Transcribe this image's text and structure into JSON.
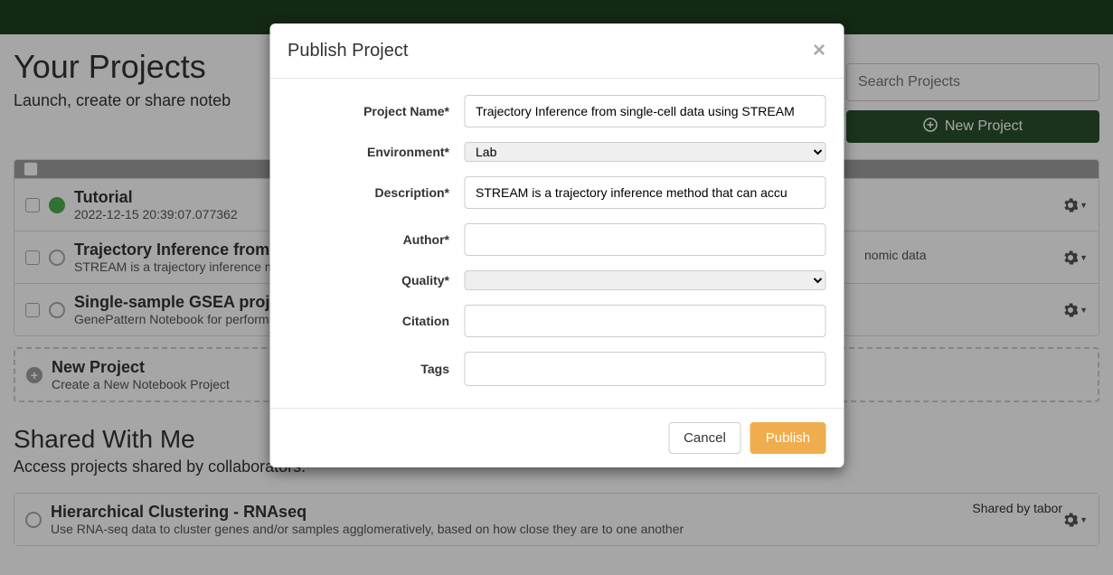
{
  "header": {
    "title": "Your Projects",
    "subtitle": "Launch, create or share noteb",
    "search_placeholder": "Search Projects",
    "new_project_btn": "New Project"
  },
  "projects": [
    {
      "title": "Tutorial",
      "subtitle": "2022-12-15 20:39:07.077362"
    },
    {
      "title": "Trajectory Inference from si",
      "subtitle": "STREAM is a trajectory inference me"
    },
    {
      "title": "Single-sample GSEA projec",
      "subtitle": "GenePattern Notebook for performin"
    }
  ],
  "orphan_text": "nomic data",
  "new_project_row": {
    "title": "New Project",
    "subtitle": "Create a New Notebook Project"
  },
  "shared": {
    "title": "Shared With Me",
    "subtitle": "Access projects shared by collaborators."
  },
  "shared_projects": [
    {
      "title": "Hierarchical Clustering - RNAseq",
      "subtitle": "Use RNA-seq data to cluster genes and/or samples agglomeratively, based on how close they are to one another",
      "shared_by": "Shared by tabor"
    }
  ],
  "modal": {
    "title": "Publish Project",
    "labels": {
      "project_name": "Project Name*",
      "environment": "Environment*",
      "description": "Description*",
      "author": "Author*",
      "quality": "Quality*",
      "citation": "Citation",
      "tags": "Tags"
    },
    "values": {
      "project_name": "Trajectory Inference from single-cell data using STREAM",
      "environment": "Lab",
      "description": "STREAM is a trajectory inference method that can accu",
      "author": "",
      "quality": "",
      "citation": "",
      "tags": ""
    },
    "buttons": {
      "cancel": "Cancel",
      "publish": "Publish"
    }
  }
}
